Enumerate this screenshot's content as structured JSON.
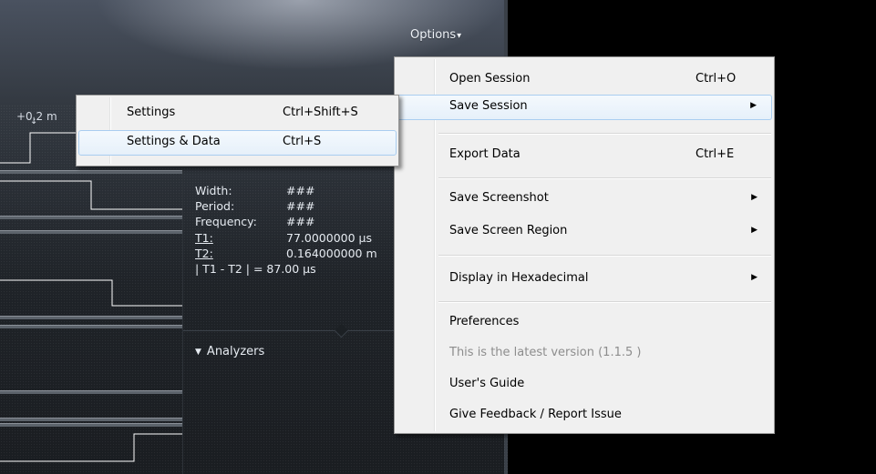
{
  "header": {
    "options_label": "Options",
    "options_caret": "▾"
  },
  "ruler": {
    "label": "+0.2 m",
    "marker": "↓"
  },
  "measurements": {
    "rows": [
      {
        "label": "Width:",
        "value": "###",
        "underline": false
      },
      {
        "label": "Period:",
        "value": "###",
        "underline": false
      },
      {
        "label": "Frequency:",
        "value": "###",
        "underline": false
      },
      {
        "label": "T1:",
        "value": "77.0000000 µs",
        "underline": true
      },
      {
        "label": "T2:",
        "value": "0.164000000 m",
        "underline": true
      }
    ],
    "difference": "| T1 - T2 | = 87.00 µs"
  },
  "analyzers": {
    "label": "Analyzers",
    "toggle_glyph": "▼"
  },
  "options_menu": {
    "items": [
      {
        "label": "Open Session",
        "shortcut": "Ctrl+O",
        "submenu": false,
        "disabled": false,
        "highlighted": false
      },
      {
        "label": "Save Session",
        "shortcut": "",
        "submenu": true,
        "disabled": false,
        "highlighted": true
      },
      {
        "label": "Export Data",
        "shortcut": "Ctrl+E",
        "submenu": false,
        "disabled": false,
        "highlighted": false
      },
      {
        "label": "Save Screenshot",
        "shortcut": "",
        "submenu": true,
        "disabled": false,
        "highlighted": false
      },
      {
        "label": "Save Screen Region",
        "shortcut": "",
        "submenu": true,
        "disabled": false,
        "highlighted": false
      },
      {
        "label": "Display in Hexadecimal",
        "shortcut": "",
        "submenu": true,
        "disabled": false,
        "highlighted": false
      },
      {
        "label": "Preferences",
        "shortcut": "",
        "submenu": false,
        "disabled": false,
        "highlighted": false
      },
      {
        "label": "This is the latest version (1.1.5 )",
        "shortcut": "",
        "submenu": false,
        "disabled": true,
        "highlighted": false
      },
      {
        "label": "User's Guide",
        "shortcut": "",
        "submenu": false,
        "disabled": false,
        "highlighted": false
      },
      {
        "label": "Give Feedback / Report Issue",
        "shortcut": "",
        "submenu": false,
        "disabled": false,
        "highlighted": false
      }
    ],
    "submenu_arrow": "▶"
  },
  "save_session_submenu": {
    "items": [
      {
        "label": "Settings",
        "shortcut": "Ctrl+Shift+S",
        "highlighted": false
      },
      {
        "label": "Settings & Data",
        "shortcut": "Ctrl+S",
        "highlighted": true
      }
    ]
  },
  "colors": {
    "menu_background": "#f0f0f0",
    "highlight_border": "#a9cdf0",
    "disabled_text": "#8d8d8d",
    "waveform": "#ffffff"
  }
}
